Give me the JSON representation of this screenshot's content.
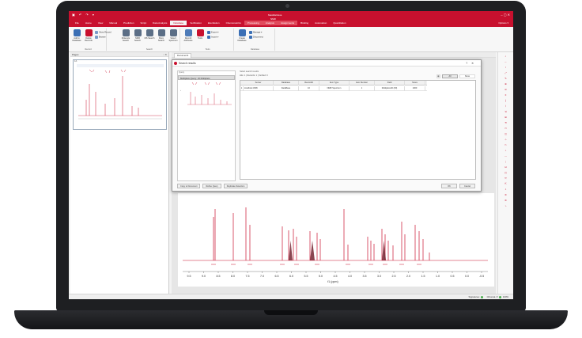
{
  "window": {
    "title": "MestReNova",
    "controls": "– ▢ ✕",
    "quick_access": "▣ ↶ ↷ ▾"
  },
  "ribbon_tabs": [
    {
      "label": "File",
      "active": false
    },
    {
      "label": "Home",
      "active": false
    },
    {
      "label": "View",
      "active": false
    },
    {
      "label": "Manual",
      "active": false
    },
    {
      "label": "Prediction",
      "active": false
    },
    {
      "label": "Script",
      "active": false
    },
    {
      "label": "Data Analysis",
      "active": false
    },
    {
      "label": "Database",
      "active": true
    },
    {
      "label": "Verification",
      "active": false
    },
    {
      "label": "Elucidation",
      "active": false
    },
    {
      "label": "Chemometrics",
      "active": false
    },
    {
      "label": "Processing",
      "active": false,
      "context": true
    },
    {
      "label": "Analysis",
      "active": false,
      "context": true
    },
    {
      "label": "Assignments",
      "active": false,
      "context": true
    },
    {
      "label": "Binding",
      "active": false
    },
    {
      "label": "Automation",
      "active": false
    },
    {
      "label": "Quantitation",
      "active": false
    }
  ],
  "context_tab_group": "NMR",
  "options_label": "Options ▾",
  "ribbon": {
    "record_group": {
      "label": "Record",
      "add_button": "Add to Database",
      "delete_button": "Delete Records",
      "show_record": "Show Record",
      "browse": "Browse"
    },
    "search_group": {
      "label": "Search",
      "molecule_search": "Molecule Search",
      "nmr_search": "NMR Search",
      "ms_search": "MS Search",
      "more_search": "More Search",
      "select_spectrum": "Select Spectrum"
    },
    "tools_group": {
      "label": "Tools",
      "record_attributes": "Record Attributes",
      "tools": "Tools",
      "export": "Export ▾",
      "import": "Import ▾"
    },
    "database_group": {
      "label": "Database",
      "create_database": "Create Database",
      "manage": "Manage ▾",
      "disconnect": "Disconnect"
    }
  },
  "pages_panel": {
    "title": "Pages",
    "thumbnail_label": "1/1"
  },
  "document_tab": "Document1",
  "dialog": {
    "title": "Search results",
    "help": "?",
    "close": "✕",
    "query_label": "Query",
    "query_selected": "Multiplets Query: 16 Multiplets",
    "results_label": "Select search results",
    "filter_text": "Hits: 1 | Records: 1 | Verified: 0",
    "button_all": "All",
    "button_none": "None",
    "columns": [
      "Server",
      "Database",
      "RecordId",
      "Item Type",
      "Item Number",
      "Field",
      "Score"
    ],
    "rows": [
      {
        "index": "1",
        "server": "localhost:3306",
        "database": "DataBase",
        "record_id": "10",
        "item_type": "NMR Spectrum",
        "item_number": "1",
        "field": "Multiplets1D (60)",
        "score": "1000"
      }
    ],
    "footer_left": [
      "Copy to Document",
      "Refine Query",
      "Duplicate Detection"
    ],
    "ok": "OK",
    "cancel": "Cancel"
  },
  "spectrum": {
    "x_axis_label": "f1 (ppm)",
    "x_ticks": [
      "9.5",
      "9.0",
      "8.5",
      "8.0",
      "7.5",
      "7.0",
      "6.5",
      "6.0",
      "5.5",
      "5.0",
      "4.5",
      "4.0",
      "3.5",
      "3.0",
      "2.5",
      "2.0",
      "1.5",
      "1.0",
      "0.5",
      "0.0",
      "-0.5"
    ]
  },
  "status": {
    "signature": "Signatures:",
    "chromatograms": "Chromat. ▾",
    "zoom": "100%"
  },
  "colors": {
    "brand_red": "#c8102e",
    "context_tab": "#e14a5c",
    "spectrum_line": "#c8102e",
    "integral_line": "#6b1826",
    "laptop_bezel": "#1e1f22"
  }
}
